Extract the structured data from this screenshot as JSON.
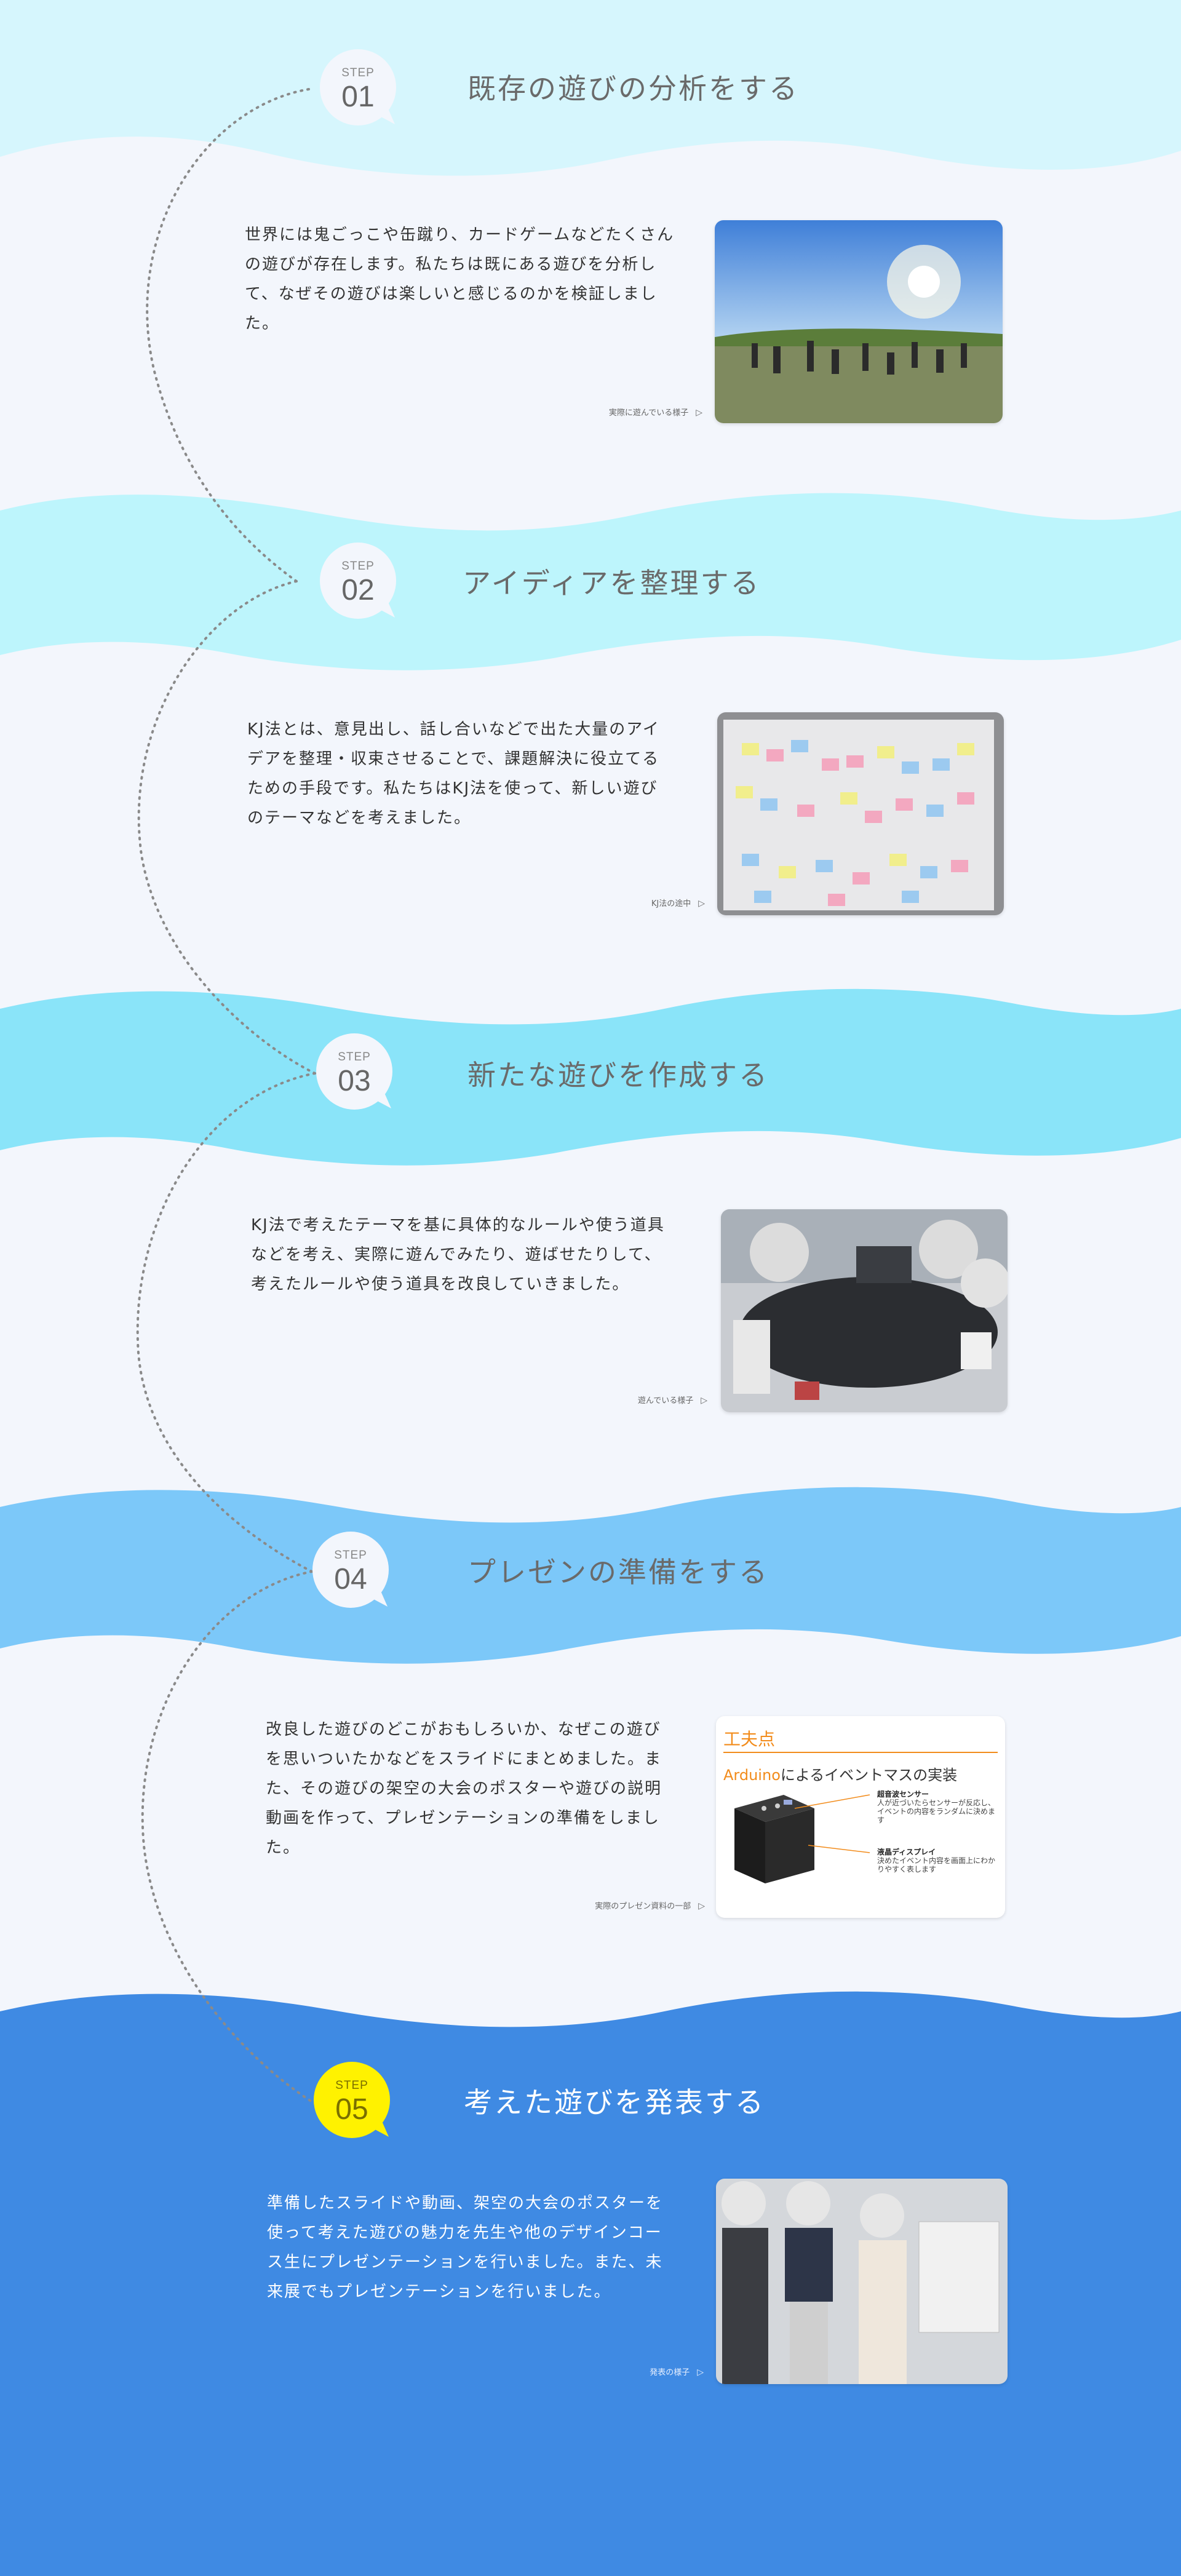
{
  "colors": {
    "page_bg": "#f3f6fc",
    "wave1": "#d6f6fd",
    "wave2": "#bdf5fc",
    "wave3": "#8ae4f9",
    "wave4": "#7cc8f9",
    "final_bg": "#3f8ae3",
    "badge_bg": "#f3f6fc",
    "badge_highlight": "#fff200",
    "slide_accent": "#f28c1c"
  },
  "steps": [
    {
      "label": "STEP",
      "num": "01",
      "title": "既存の遊びの分析をする",
      "desc": "世界には鬼ごっこや缶蹴り、カードゲームなどたくさんの遊びが存在します。私たちは既にある遊びを分析して、なぜその遊びは楽しいと感じるのかを検証しました。",
      "caption": "実際に遊んでいる様子",
      "image": "outdoor-play-photo"
    },
    {
      "label": "STEP",
      "num": "02",
      "title": "アイディアを整理する",
      "desc": "KJ法とは、意見出し、話し合いなどで出た大量のアイデアを整理・収束させることで、課題解決に役立てるための手段です。私たちはKJ法を使って、新しい遊びのテーマなどを考えました。",
      "caption": "KJ法の途中",
      "image": "sticky-notes-photo"
    },
    {
      "label": "STEP",
      "num": "03",
      "title": "新たな遊びを作成する",
      "desc": "KJ法で考えたテーマを基に具体的なルールや使う道具などを考え、実際に遊んでみたり、遊ばせたりして、考えたルールや使う道具を改良していきました。",
      "caption": "遊んでいる様子",
      "image": "table-play-photo"
    },
    {
      "label": "STEP",
      "num": "04",
      "title": "プレゼンの準備をする",
      "desc": "改良した遊びのどこがおもしろいか、なぜこの遊びを思いついたかなどをスライドにまとめました。また、その遊びの架空の大会のポスターや遊びの説明動画を作って、プレゼンテーションの準備をしました。",
      "caption": "実際のプレゼン資料の一部",
      "image": "presentation-slide"
    },
    {
      "label": "STEP",
      "num": "05",
      "title": "考えた遊びを発表する",
      "desc": "準備したスライドや動画、架空の大会のポスターを使って考えた遊びの魅力を先生や他のデザインコース生にプレゼンテーションを行いました。また、未来展でもプレゼンテーションを行いました。",
      "caption": "発表の様子",
      "image": "presenters-photo"
    }
  ],
  "slide": {
    "title": "工夫点",
    "subtitle_accent": "Arduino",
    "subtitle_rest": "によるイベントマスの実装",
    "note1_title": "超音波センサー",
    "note1_body": "人が近づいたらセンサーが反応し、イベントの内容をランダムに決めます",
    "note2_title": "液晶ディスプレイ",
    "note2_body": "決めたイベント内容を画面上にわかりやすく表します"
  }
}
